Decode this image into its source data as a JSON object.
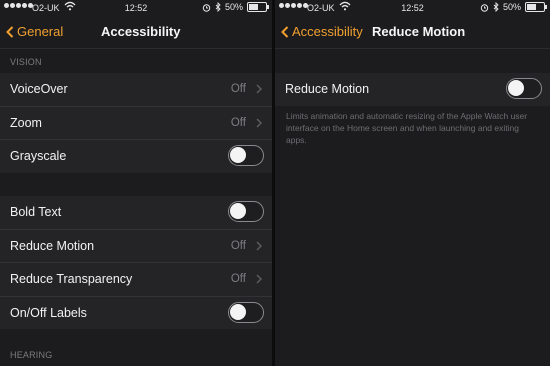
{
  "left": {
    "status": {
      "carrier": "O2-UK",
      "time": "12:52",
      "battery": "50%"
    },
    "nav": {
      "back_label": "General",
      "title": "Accessibility"
    },
    "vision": {
      "header": "VISION",
      "rows_a": [
        {
          "label": "VoiceOver",
          "value": "Off"
        },
        {
          "label": "Zoom",
          "value": "Off"
        },
        {
          "label": "Grayscale",
          "toggle": "off"
        }
      ],
      "rows_b": [
        {
          "label": "Bold Text",
          "toggle": "off"
        },
        {
          "label": "Reduce Motion",
          "value": "Off"
        },
        {
          "label": "Reduce Transparency",
          "value": "Off"
        },
        {
          "label": "On/Off Labels",
          "toggle": "off"
        }
      ]
    },
    "hearing": {
      "header": "HEARING"
    }
  },
  "right": {
    "status": {
      "carrier": "O2-UK",
      "time": "12:52",
      "battery": "50%"
    },
    "nav": {
      "back_label": "Accessibility",
      "title": "Reduce Motion"
    },
    "row": {
      "label": "Reduce Motion",
      "toggle": "off"
    },
    "description": "Limits animation and automatic resizing of the Apple Watch user interface on the Home screen and when launching and exiting apps."
  },
  "colors": {
    "accent": "#f0a030",
    "background": "#1c1c1e",
    "cell": "#242426"
  },
  "icons": [
    "wifi-icon",
    "alarm-icon",
    "bluetooth-icon",
    "battery-icon",
    "chevron-left-icon",
    "disclosure-chevron-icon"
  ]
}
